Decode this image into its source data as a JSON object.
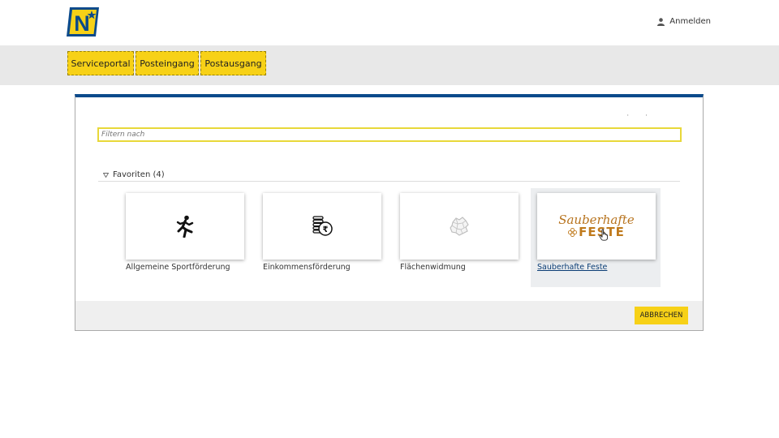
{
  "header": {
    "logo_letter": "N",
    "login_label": "Anmelden",
    "colors": {
      "logo_blue": "#0b4a8b",
      "accent_yellow": "#f7d117"
    }
  },
  "nav": {
    "items": [
      {
        "label": "Serviceportal"
      },
      {
        "label": "Posteingang"
      },
      {
        "label": "Postausgang"
      }
    ]
  },
  "dialog": {
    "filter": {
      "value": "",
      "placeholder": "Filtern nach"
    },
    "favorites_label": "Favoriten (4)",
    "cards": [
      {
        "label": "Allgemeine Sportförderung",
        "icon": "runner-icon"
      },
      {
        "label": "Einkommensförderung",
        "icon": "coins-rupee-icon"
      },
      {
        "label": "Flächenwidmung",
        "icon": "map-region-icon"
      },
      {
        "label": "Sauberhafte Feste",
        "icon": "sauberhafte-feste-logo",
        "logo_line1": "Sauberhafte",
        "logo_line2": "FESTE"
      }
    ],
    "cancel_label": "ABBRECHEN"
  }
}
